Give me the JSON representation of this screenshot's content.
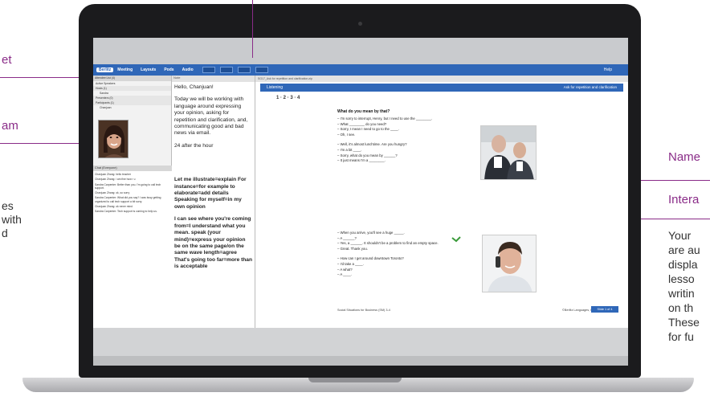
{
  "callouts": {
    "left_1": "et",
    "left_2": "am",
    "left_3": "es",
    "left_4": "with",
    "left_5": "d",
    "right_1": "Name",
    "right_2": "Intera",
    "right_3": "Your",
    "right_4": "are au",
    "right_5": "displa",
    "right_6": "lesso",
    "right_7": "writin",
    "right_8": "on th",
    "right_9": "These",
    "right_10": "for fu"
  },
  "menubar": {
    "brand": "Berlitz",
    "items": [
      "Meeting",
      "Layouts",
      "Pods",
      "Audio"
    ],
    "help": "Help"
  },
  "attendees": {
    "header": "Attendee List (4)",
    "rows": [
      "Active Speakers",
      "Hosts (1)",
      "Sandra",
      "Presenters (0)",
      "Participants (1)",
      "Chanjuan"
    ]
  },
  "notes": {
    "header": "Note",
    "paragraphs": [
      "Hello, Chanjuan!",
      "Today we will be working with language around expressing your opinion, asking for repetition and clarification, and, communicating good and bad news via email.",
      "24 after the hour",
      "Let me illustrate=explain For instance=for example to elaborate=add details Speaking for myself=in my own opinion",
      "I can see where you're coming from=I understand what you mean. speak (your mind)=express your opinion be on the same page/on the same wave length=agree That's going too far=more than is acceptable"
    ]
  },
  "chat": {
    "header": "Chat (Everyone)",
    "lines": [
      "Chanjuan Zhang: hello teacher",
      "Chanjuan Zhang: i am fine how r u",
      "Sandra Carpenter: Better than you. I'm going to call tech support.",
      "Chanjuan Zhang: ok, so sorry",
      "Sandra Carpenter: What did you say? I was busy getting organized to call tech support a bit sorry.",
      "Chanjuan Zhang: ok never mind",
      "Sandra Carpenter: Tech support is coming to help us."
    ]
  },
  "content": {
    "file_title": "SG17_Ask for repetition and clarification.zip",
    "tab": "Listening",
    "bar_title": "Ask for repetition and clarification",
    "pages": "1 · 2 · 3 · 4",
    "slide_title": "What do you mean by that?",
    "dialog1": [
      "– I'm sorry to interrupt, Henry, but I need to use the ________.",
      "– What ________ do you need?",
      "– Sorry, I mean I need to go to the ____.",
      "– Oh, I see.",
      "– Well, it's almost lunchtime. Are you hungry?",
      "– I'm a bit ____.",
      "– Sorry, what do you mean by ______?",
      "– It just means I'm a ________."
    ],
    "dialog2": [
      "– When you arrive, you'll see a huge _____.",
      "– A ______?",
      "– Yes, a ______. It shouldn't be a problem to find an empty space.",
      "– Great. Thank you.",
      "– How can I get around downtown Toronto?",
      "– I'd take a ____.",
      "– A what?",
      "– A ____."
    ],
    "footer_left": "Social Situations for Business (SM) 3-4",
    "footer_right": "©Berlitz Languages, Inc.",
    "slide_button": "Slide 1 of 4"
  }
}
